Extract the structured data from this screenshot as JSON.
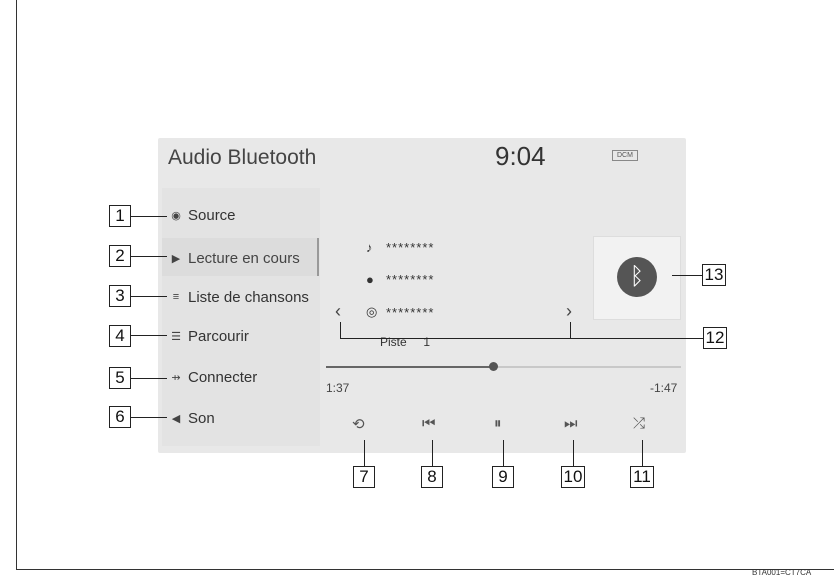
{
  "header": {
    "title": "Audio Bluetooth",
    "clock": "9:04",
    "badge": "DCM"
  },
  "menu": [
    {
      "label": "Source",
      "icon": "source-icon"
    },
    {
      "label": "Lecture en cours",
      "icon": "play-circle-icon",
      "active": true
    },
    {
      "label": "Liste de chansons",
      "icon": "song-list-icon"
    },
    {
      "label": "Parcourir",
      "icon": "browse-icon"
    },
    {
      "label": "Connecter",
      "icon": "connect-icon"
    },
    {
      "label": "Son",
      "icon": "speaker-icon"
    }
  ],
  "track": {
    "title": "********",
    "artist": "********",
    "album": "********",
    "track_label": "Piste",
    "track_number": "1"
  },
  "progress": {
    "elapsed": "1:37",
    "remaining": "-1:47",
    "fraction": 0.47
  },
  "controls": [
    {
      "name": "repeat-button",
      "icon": "repeat-icon",
      "glyph": "⟲"
    },
    {
      "name": "previous-button",
      "icon": "skip-back-icon",
      "glyph": "⏮"
    },
    {
      "name": "pause-button",
      "icon": "pause-icon",
      "glyph": "⏸"
    },
    {
      "name": "next-button",
      "icon": "skip-forward-icon",
      "glyph": "⏭"
    },
    {
      "name": "shuffle-button",
      "icon": "shuffle-icon",
      "glyph": "⤮"
    }
  ],
  "callouts": [
    "1",
    "2",
    "3",
    "4",
    "5",
    "6",
    "7",
    "8",
    "9",
    "10",
    "11",
    "12",
    "13"
  ],
  "footer": "BTA001=CT7CA"
}
